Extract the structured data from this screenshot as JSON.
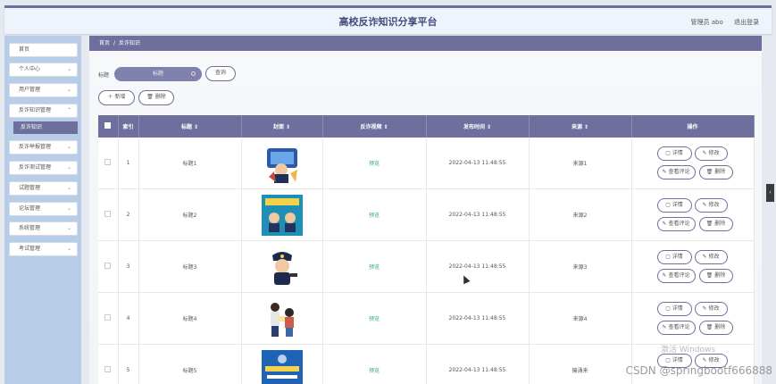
{
  "header": {
    "title": "高校反诈知识分享平台",
    "user_label": "管理员 abo",
    "logout_label": "退出登录"
  },
  "sidebar": {
    "items": [
      {
        "label": "首页",
        "has_chevron": false
      },
      {
        "label": "个人中心",
        "has_chevron": true
      },
      {
        "label": "用户管理",
        "has_chevron": true
      },
      {
        "label": "反诈知识管理",
        "has_chevron": true
      },
      {
        "label": "反诈举报管理",
        "has_chevron": true
      },
      {
        "label": "反诈测试管理",
        "has_chevron": true
      },
      {
        "label": "试题管理",
        "has_chevron": true
      },
      {
        "label": "论坛管理",
        "has_chevron": true
      },
      {
        "label": "系统管理",
        "has_chevron": true
      },
      {
        "label": "考试管理",
        "has_chevron": true
      }
    ],
    "active_sub": "反诈知识"
  },
  "breadcrumb": {
    "home": "首页",
    "separator": "/",
    "current": "反诈知识"
  },
  "search": {
    "label": "标题",
    "placeholder": "标题",
    "button": "查询"
  },
  "actions": {
    "add": "＋ 新增",
    "delete": "🗑 删除"
  },
  "table": {
    "columns": [
      "索引",
      "标题 ⇕",
      "封面 ⇕",
      "反诈视频 ⇕",
      "发布时间 ⇕",
      "来源 ⇕",
      "操作"
    ],
    "preview_label": "预览",
    "op_labels": {
      "detail": "▢ 详情",
      "edit": "✎ 修改",
      "comment": "✎ 查看评论",
      "delete": "🗑 删除"
    },
    "rows": [
      {
        "index": "1",
        "title": "标题1",
        "video": "预览",
        "time": "2022-04-13 11:48:55",
        "source": "来源1"
      },
      {
        "index": "2",
        "title": "标题2",
        "video": "预览",
        "time": "2022-04-13 11:48:55",
        "source": "来源2"
      },
      {
        "index": "3",
        "title": "标题3",
        "video": "预览",
        "time": "2022-04-13 11:48:55",
        "source": "来源3"
      },
      {
        "index": "4",
        "title": "标题4",
        "video": "预览",
        "time": "2022-04-13 11:48:55",
        "source": "来源4"
      },
      {
        "index": "5",
        "title": "标题5",
        "video": "预览",
        "time": "2022-04-13 11:48:55",
        "source": "输涌来"
      }
    ]
  },
  "watermark": "CSDN @springbootf666888",
  "windows_watermark": "激活 Windows",
  "colors": {
    "primary": "#6e6f9c",
    "sidebar_bg": "#b8cde8",
    "preview": "#3aa87a"
  }
}
